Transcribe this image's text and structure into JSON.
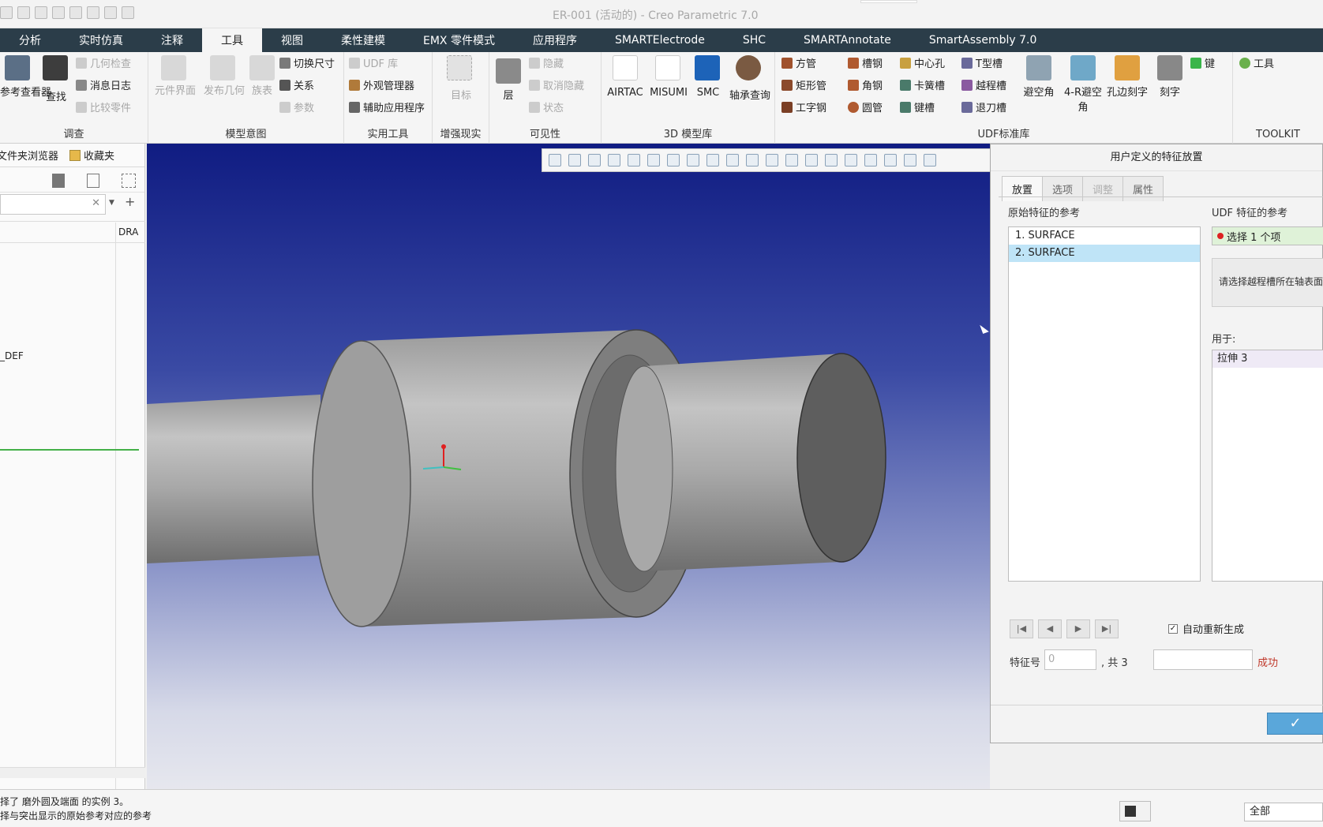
{
  "window": {
    "title": "ER-001 (活动的) - Creo Parametric 7.0"
  },
  "ribbon_tabs": [
    "分析",
    "实时仿真",
    "注释",
    "工具",
    "视图",
    "柔性建模",
    "EMX 零件模式",
    "应用程序",
    "SMARTElectrode",
    "SHC",
    "SMARTAnnotate",
    "SmartAssembly 7.0"
  ],
  "active_tab": "工具",
  "ribbon": {
    "investigate": {
      "label": "调查",
      "items": [
        "参考查看器",
        "查找",
        "几何检查",
        "消息日志",
        "比较零件"
      ]
    },
    "model_intent": {
      "label": "模型意图",
      "items": [
        "元件界面",
        "发布几何",
        "族表",
        "切换尺寸",
        "关系",
        "参数"
      ]
    },
    "utilities": {
      "label": "实用工具",
      "items": [
        "UDF 库",
        "外观管理器",
        "辅助应用程序"
      ]
    },
    "ar": {
      "label": "增强现实",
      "items": [
        "目标"
      ]
    },
    "visibility": {
      "label": "可见性",
      "items": [
        "层",
        "隐藏",
        "取消隐藏",
        "状态"
      ]
    },
    "lib3d": {
      "label": "3D 模型库",
      "items": [
        "AIRTAC",
        "MISUMI",
        "SMC",
        "轴承查询"
      ]
    },
    "udf": {
      "label": "UDF标准库",
      "items": [
        "方管",
        "矩形管",
        "工字钢",
        "槽钢",
        "角钢",
        "圆管",
        "中心孔",
        "卡簧槽",
        "键槽",
        "T型槽",
        "越程槽",
        "退刀槽",
        "避空角",
        "4-R避空角",
        "孔边刻字",
        "刻字",
        "键"
      ]
    },
    "toolkit": {
      "label": "TOOLKIT",
      "items": [
        "工具"
      ]
    }
  },
  "left_panel": {
    "tabs": [
      "文件夹浏览器",
      "收藏夹"
    ],
    "column_header": "DRA",
    "tree_item": "_DEF"
  },
  "dialog": {
    "title": "用户定义的特征放置",
    "tabs": [
      "放置",
      "选项",
      "调整",
      "属性"
    ],
    "original_refs_label": "原始特征的参考",
    "udf_refs_label": "UDF 特征的参考",
    "original_refs": [
      "1. SURFACE",
      "2. SURFACE"
    ],
    "selected_index": 1,
    "udf_ref_value": "选择 1 个项",
    "hint": "请选择越程槽所在轴表面",
    "used_for_label": "用于:",
    "used_for": [
      "拉伸 3"
    ],
    "auto_regen": "自动重新生成",
    "feature_no_label": "特征号",
    "feature_no_value": "0",
    "feature_total": ", 共 3",
    "status": "成功"
  },
  "status_bar": {
    "line1": "择了 磨外圆及端面 的实例 3。",
    "line2": "择与突出显示的原始参考对应的参考",
    "filter": "全部"
  },
  "colors": {
    "tab_bar": "#2b3d49",
    "viewport_top": "#101c82",
    "ok_button": "#5aa7da",
    "status_success": "#c0392b"
  }
}
